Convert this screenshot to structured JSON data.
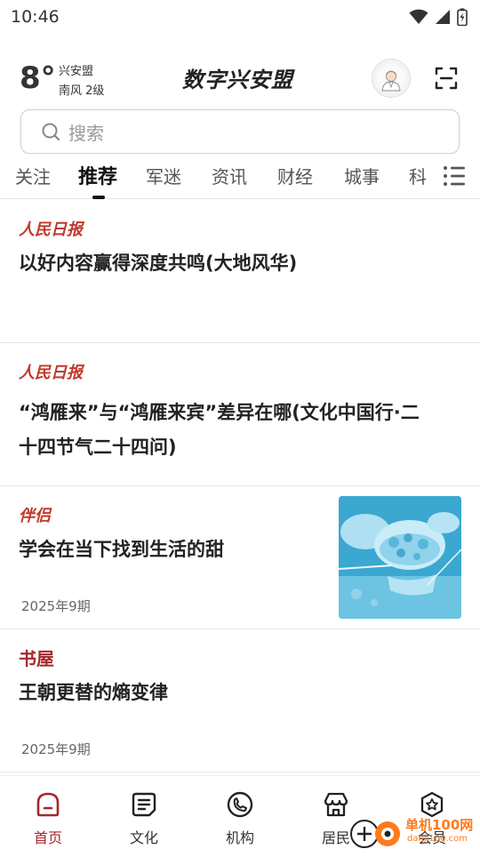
{
  "status_bar": {
    "time": "10:46"
  },
  "weather": {
    "temperature": "8°",
    "city": "兴安盟",
    "wind": "南风  2级"
  },
  "app": {
    "logo": "数字兴安盟"
  },
  "search": {
    "placeholder": "搜索"
  },
  "tabs": [
    {
      "label": "关注"
    },
    {
      "label": "推荐",
      "active": true
    },
    {
      "label": "军迷"
    },
    {
      "label": "资讯"
    },
    {
      "label": "财经"
    },
    {
      "label": "城事"
    },
    {
      "label": "科"
    }
  ],
  "articles": [
    {
      "source": "人民日报",
      "title": "以好内容赢得深度共鸣(大地风华)"
    },
    {
      "source": "人民日报",
      "title_line1": "“鸿雁来”与“鸿雁来宾”差异在哪(文化中国行·二",
      "title_line2": "十四节气二十四问)"
    },
    {
      "source": "伴侣",
      "title": "学会在当下找到生活的甜",
      "issue": "2025年9期"
    },
    {
      "source": "书屋",
      "title": "王朝更替的熵变律",
      "issue": "2025年9期"
    }
  ],
  "bottom_nav": [
    {
      "label": "首页",
      "icon": "home-icon",
      "active": true
    },
    {
      "label": "文化",
      "icon": "document-icon"
    },
    {
      "label": "机构",
      "icon": "phone-icon"
    },
    {
      "label": "居民",
      "icon": "shop-icon"
    },
    {
      "label": "会员",
      "icon": "star-badge-icon"
    }
  ],
  "watermark": {
    "text": "单机100网",
    "sub": "danji100.com"
  },
  "colors": {
    "accent": "#a3272c",
    "source_red": "#c0392b"
  }
}
